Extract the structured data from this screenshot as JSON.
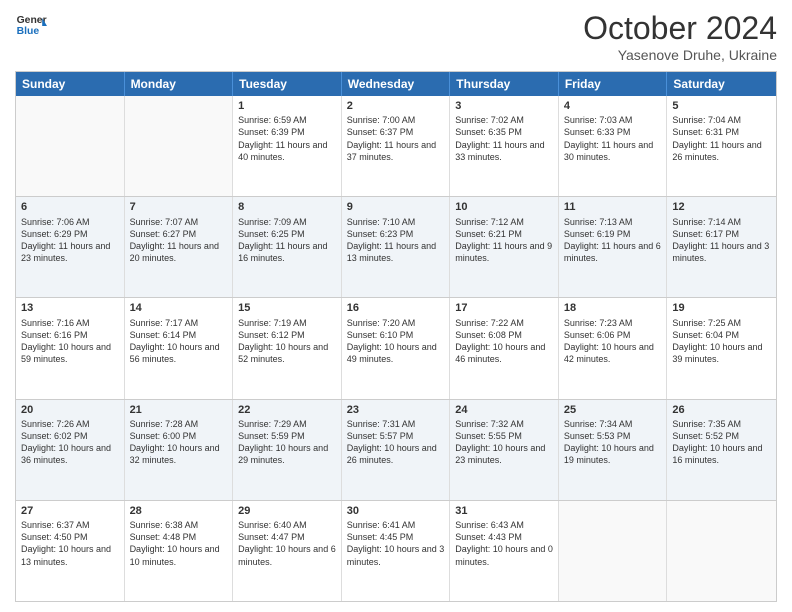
{
  "header": {
    "logo_line1": "General",
    "logo_line2": "Blue",
    "month": "October 2024",
    "location": "Yasenove Druhe, Ukraine"
  },
  "days_of_week": [
    "Sunday",
    "Monday",
    "Tuesday",
    "Wednesday",
    "Thursday",
    "Friday",
    "Saturday"
  ],
  "weeks": [
    [
      {
        "day": "",
        "content": ""
      },
      {
        "day": "",
        "content": ""
      },
      {
        "day": "1",
        "content": "Sunrise: 6:59 AM\nSunset: 6:39 PM\nDaylight: 11 hours and 40 minutes."
      },
      {
        "day": "2",
        "content": "Sunrise: 7:00 AM\nSunset: 6:37 PM\nDaylight: 11 hours and 37 minutes."
      },
      {
        "day": "3",
        "content": "Sunrise: 7:02 AM\nSunset: 6:35 PM\nDaylight: 11 hours and 33 minutes."
      },
      {
        "day": "4",
        "content": "Sunrise: 7:03 AM\nSunset: 6:33 PM\nDaylight: 11 hours and 30 minutes."
      },
      {
        "day": "5",
        "content": "Sunrise: 7:04 AM\nSunset: 6:31 PM\nDaylight: 11 hours and 26 minutes."
      }
    ],
    [
      {
        "day": "6",
        "content": "Sunrise: 7:06 AM\nSunset: 6:29 PM\nDaylight: 11 hours and 23 minutes."
      },
      {
        "day": "7",
        "content": "Sunrise: 7:07 AM\nSunset: 6:27 PM\nDaylight: 11 hours and 20 minutes."
      },
      {
        "day": "8",
        "content": "Sunrise: 7:09 AM\nSunset: 6:25 PM\nDaylight: 11 hours and 16 minutes."
      },
      {
        "day": "9",
        "content": "Sunrise: 7:10 AM\nSunset: 6:23 PM\nDaylight: 11 hours and 13 minutes."
      },
      {
        "day": "10",
        "content": "Sunrise: 7:12 AM\nSunset: 6:21 PM\nDaylight: 11 hours and 9 minutes."
      },
      {
        "day": "11",
        "content": "Sunrise: 7:13 AM\nSunset: 6:19 PM\nDaylight: 11 hours and 6 minutes."
      },
      {
        "day": "12",
        "content": "Sunrise: 7:14 AM\nSunset: 6:17 PM\nDaylight: 11 hours and 3 minutes."
      }
    ],
    [
      {
        "day": "13",
        "content": "Sunrise: 7:16 AM\nSunset: 6:16 PM\nDaylight: 10 hours and 59 minutes."
      },
      {
        "day": "14",
        "content": "Sunrise: 7:17 AM\nSunset: 6:14 PM\nDaylight: 10 hours and 56 minutes."
      },
      {
        "day": "15",
        "content": "Sunrise: 7:19 AM\nSunset: 6:12 PM\nDaylight: 10 hours and 52 minutes."
      },
      {
        "day": "16",
        "content": "Sunrise: 7:20 AM\nSunset: 6:10 PM\nDaylight: 10 hours and 49 minutes."
      },
      {
        "day": "17",
        "content": "Sunrise: 7:22 AM\nSunset: 6:08 PM\nDaylight: 10 hours and 46 minutes."
      },
      {
        "day": "18",
        "content": "Sunrise: 7:23 AM\nSunset: 6:06 PM\nDaylight: 10 hours and 42 minutes."
      },
      {
        "day": "19",
        "content": "Sunrise: 7:25 AM\nSunset: 6:04 PM\nDaylight: 10 hours and 39 minutes."
      }
    ],
    [
      {
        "day": "20",
        "content": "Sunrise: 7:26 AM\nSunset: 6:02 PM\nDaylight: 10 hours and 36 minutes."
      },
      {
        "day": "21",
        "content": "Sunrise: 7:28 AM\nSunset: 6:00 PM\nDaylight: 10 hours and 32 minutes."
      },
      {
        "day": "22",
        "content": "Sunrise: 7:29 AM\nSunset: 5:59 PM\nDaylight: 10 hours and 29 minutes."
      },
      {
        "day": "23",
        "content": "Sunrise: 7:31 AM\nSunset: 5:57 PM\nDaylight: 10 hours and 26 minutes."
      },
      {
        "day": "24",
        "content": "Sunrise: 7:32 AM\nSunset: 5:55 PM\nDaylight: 10 hours and 23 minutes."
      },
      {
        "day": "25",
        "content": "Sunrise: 7:34 AM\nSunset: 5:53 PM\nDaylight: 10 hours and 19 minutes."
      },
      {
        "day": "26",
        "content": "Sunrise: 7:35 AM\nSunset: 5:52 PM\nDaylight: 10 hours and 16 minutes."
      }
    ],
    [
      {
        "day": "27",
        "content": "Sunrise: 6:37 AM\nSunset: 4:50 PM\nDaylight: 10 hours and 13 minutes."
      },
      {
        "day": "28",
        "content": "Sunrise: 6:38 AM\nSunset: 4:48 PM\nDaylight: 10 hours and 10 minutes."
      },
      {
        "day": "29",
        "content": "Sunrise: 6:40 AM\nSunset: 4:47 PM\nDaylight: 10 hours and 6 minutes."
      },
      {
        "day": "30",
        "content": "Sunrise: 6:41 AM\nSunset: 4:45 PM\nDaylight: 10 hours and 3 minutes."
      },
      {
        "day": "31",
        "content": "Sunrise: 6:43 AM\nSunset: 4:43 PM\nDaylight: 10 hours and 0 minutes."
      },
      {
        "day": "",
        "content": ""
      },
      {
        "day": "",
        "content": ""
      }
    ]
  ]
}
